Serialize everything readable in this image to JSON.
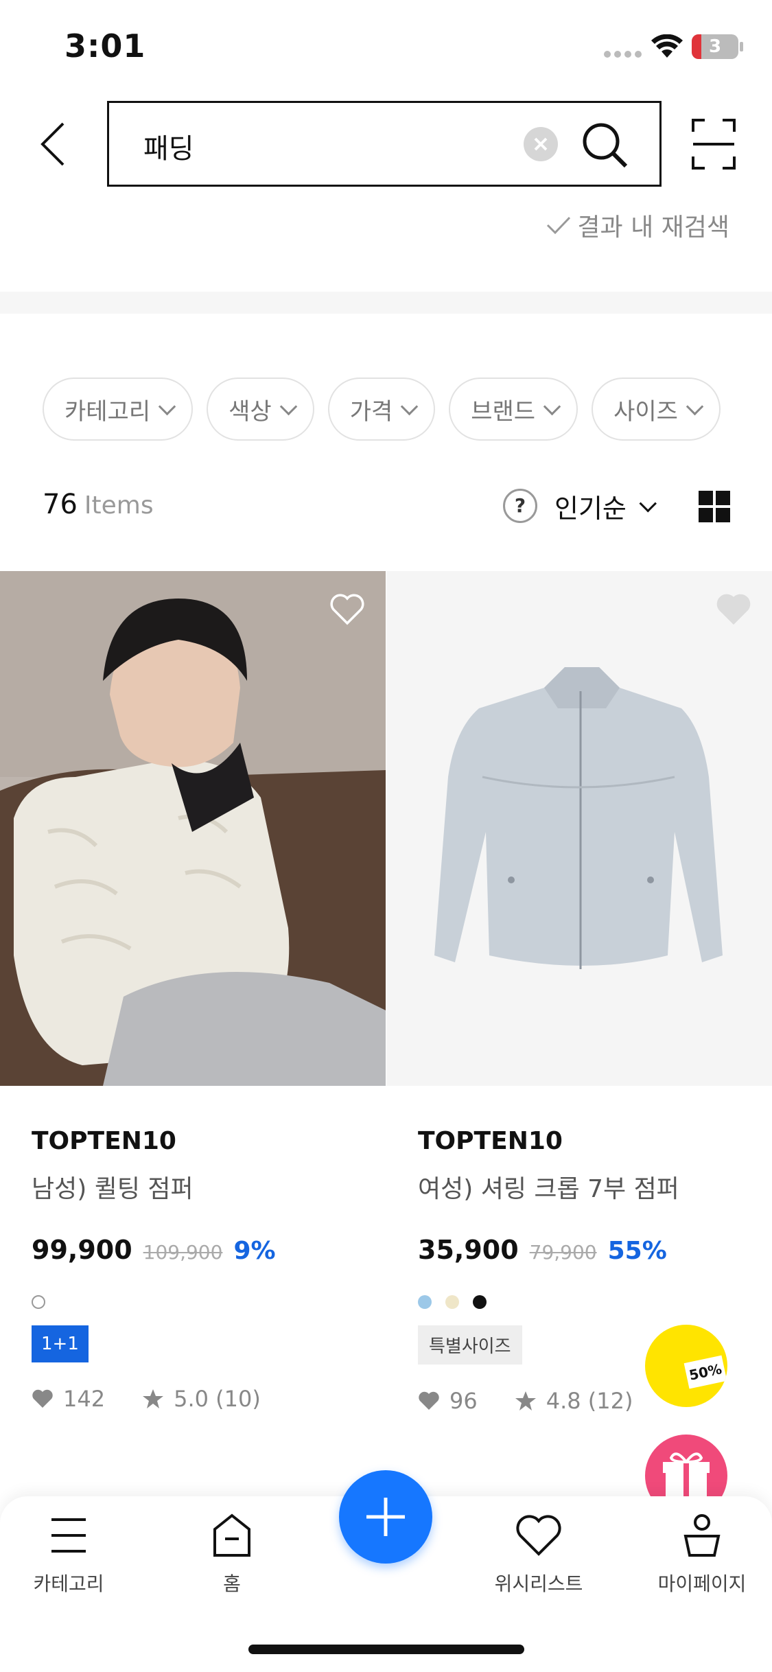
{
  "status_bar": {
    "time": "3:01",
    "battery": "3"
  },
  "search": {
    "query": "패딩",
    "refine_label": "결과 내 재검색"
  },
  "filters": [
    "카테고리",
    "색상",
    "가격",
    "브랜드",
    "사이즈"
  ],
  "results": {
    "count": "76",
    "items_label": "Items",
    "sort_label": "인기순"
  },
  "products": [
    {
      "brand": "TOPTEN10",
      "name": "남성) 퀼팅 점퍼",
      "price": "99,900",
      "original_price": "109,900",
      "discount": "9%",
      "badge": "1+1",
      "likes": "142",
      "rating": "5.0 (10)",
      "colors": [
        "#ffffff"
      ]
    },
    {
      "brand": "TOPTEN10",
      "name": "여성) 셔링 크롭 7부 점퍼",
      "price": "35,900",
      "original_price": "79,900",
      "discount": "55%",
      "badge": "특별사이즈",
      "likes": "96",
      "rating": "4.8 (12)",
      "colors": [
        "#9cc8e8",
        "#efe6c8",
        "#111111"
      ]
    }
  ],
  "promos": {
    "yellow_tag": "50%"
  },
  "nav": {
    "category": "카테고리",
    "home": "홈",
    "wishlist": "위시리스트",
    "mypage": "마이페이지"
  },
  "colors": {
    "accent": "#1677ff",
    "discount": "#1565e0",
    "promo_yellow": "#ffe400",
    "promo_pink": "#f04a7a"
  }
}
